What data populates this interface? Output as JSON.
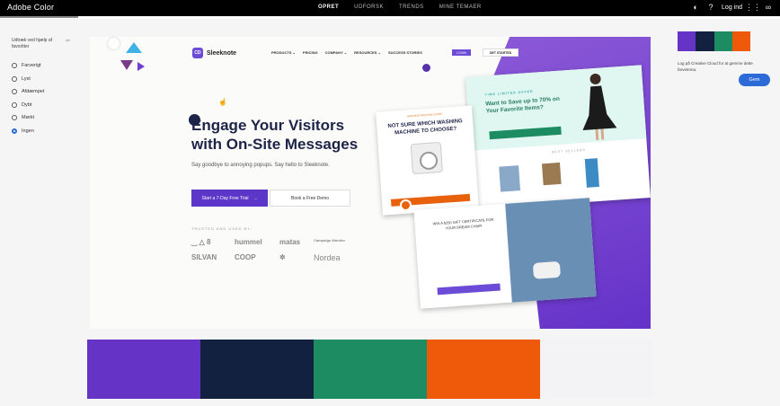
{
  "app": {
    "brand": "Adobe Color",
    "nav": [
      "OPRET",
      "UDFORSK",
      "TRENDS",
      "MINE TEMAER"
    ],
    "active_nav": 0,
    "login_label": "Log ind"
  },
  "sidebar": {
    "heading": "Udtræk ved hjælp af favoritter",
    "options": [
      "Farverigt",
      "Lyst",
      "Afdæmpet",
      "Dybt",
      "Mørkt",
      "Ingen"
    ],
    "selected": 5
  },
  "preview": {
    "logo": "Sleeknote",
    "nav": [
      "PRODUCTS ⌄",
      "PRICING",
      "COMPANY ⌄",
      "RESOURCES ⌄",
      "SUCCESS STORIES"
    ],
    "login": "LOGIN",
    "started": "GET STARTED",
    "headline_1": "Engage Your Visitors",
    "headline_2": "with On-Site Messages",
    "subline": "Say goodbye to annoying popups. Say hello to Sleeknote.",
    "trial_button": "Start a 7-Day Free Trial",
    "trial_arrow": "→",
    "demo_button": "Book a Free Demo",
    "trusted": "TRUSTED AND USED BY:",
    "clients": [
      "‿ △ 8",
      "hummel",
      "matas",
      "Campaign Monitor",
      "SILVAN",
      "COOP",
      "✲",
      "Nordea"
    ],
    "card_a_tag": "WASHING MACHINE GUIDE",
    "card_a_title": "NOT SURE WHICH WASHING MACHINE TO CHOOSE?",
    "card_b_tag": "TIME LIMITED OFFER",
    "card_b_title": "Want to Save up to 70% on Your Favorite Items?",
    "card_b_best": "BEST SELLERS",
    "card_c_title": "WIN A $250 GIFT CERTIFICATE FOR YOUR DREAM CHAIR"
  },
  "palette": {
    "colors": [
      "#6534C6",
      "#132140",
      "#1E8C62",
      "#EE5A09",
      "#F3F3F5"
    ]
  },
  "right_panel": {
    "save_text": "Log på Creative Cloud for at gemme dette farvetema.",
    "save_button": "Gem"
  },
  "progress_fraction": 0.1
}
